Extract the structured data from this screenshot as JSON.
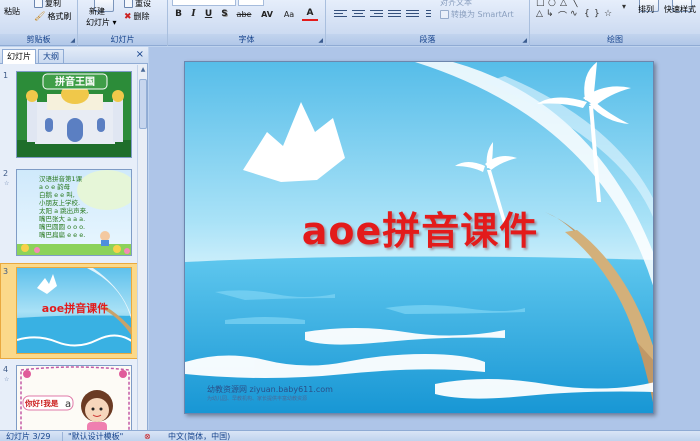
{
  "ribbon": {
    "clipboard": {
      "label": "剪贴板",
      "paste": "粘贴",
      "copy": "复制",
      "format_painter": "格式刷"
    },
    "slides": {
      "label": "幻灯片",
      "new_slide": "新建",
      "new_slide_2": "幻灯片",
      "reset": "重设",
      "delete": "删除"
    },
    "font": {
      "label": "字体",
      "bold": "B",
      "italic": "I",
      "underline": "U",
      "shadow": "S",
      "strike": "abe",
      "spacing": "AV",
      "case": "Aa",
      "color": "A"
    },
    "paragraph": {
      "label": "段落",
      "align_text": "对齐文本",
      "convert_smartart": "转换为 SmartArt"
    },
    "drawing": {
      "label": "绘图",
      "arrange": "排列",
      "quick_styles": "快速样式"
    }
  },
  "leftpanel": {
    "tabs": [
      "幻灯片",
      "大纲"
    ],
    "close": "×",
    "slides": [
      {
        "num": "1",
        "title": "拼音王国"
      },
      {
        "num": "2",
        "lines": [
          "汉语拼音第1课",
          "a o e 韵母",
          "白鹅 e e 叫,",
          "小朋友上学校.",
          "太阳 a 跳出声来,",
          "嘴巴张大 a a a.",
          "嘴巴圆圆 o o o.",
          "嘴巴扁扁 e e e."
        ]
      },
      {
        "num": "3",
        "title": "aoe拼音课件"
      },
      {
        "num": "4",
        "title": "你好!我是",
        "letter": "a"
      }
    ]
  },
  "slide": {
    "title": "aoe拼音课件",
    "footer": "幼教资源网 ziyuan.baby611.com",
    "footer_small": "为幼儿园、早教机构、家长提供丰富幼教资源"
  },
  "statusbar": {
    "slide_count": "幻灯片 3/29",
    "theme": "\"默认设计模板\"",
    "language": "中文(简体，中国)"
  },
  "colors": {
    "title_red": "#e31b1b",
    "ribbon_bg": "#cedcf2",
    "selected_thumb": "#fbd98a"
  }
}
